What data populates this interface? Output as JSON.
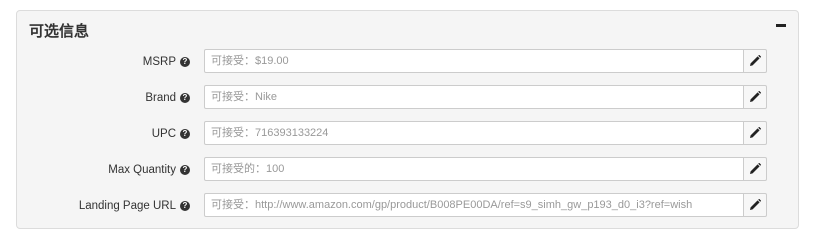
{
  "panel": {
    "title": "可选信息",
    "collapse_icon": "minus-icon"
  },
  "fields": [
    {
      "label": "MSRP",
      "placeholder": "可接受：$19.00",
      "value": ""
    },
    {
      "label": "Brand",
      "placeholder": "可接受：Nike",
      "value": ""
    },
    {
      "label": "UPC",
      "placeholder": "可接受：716393133224",
      "value": ""
    },
    {
      "label": "Max Quantity",
      "placeholder": "可接受的：100",
      "value": ""
    },
    {
      "label": "Landing Page URL",
      "placeholder": "可接受：http://www.amazon.com/gp/product/B008PE00DA/ref=s9_simh_gw_p193_d0_i3?ref=wish",
      "value": ""
    }
  ],
  "icons": {
    "help": "question-circle-icon",
    "edit": "pencil-icon"
  }
}
